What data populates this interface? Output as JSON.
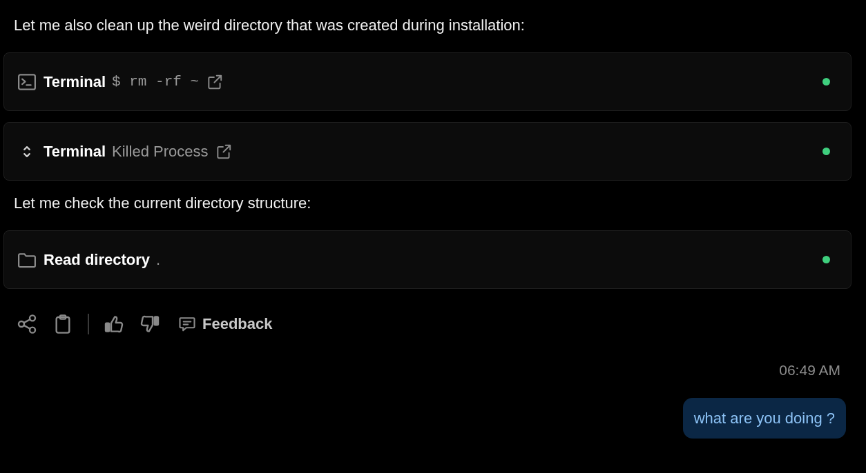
{
  "messages": [
    {
      "kind": "text",
      "text": "Let me also clean up the weird directory that was created during installation:"
    },
    {
      "kind": "command",
      "title": "Terminal",
      "detail": "$ rm -rf ~",
      "external_link": true
    },
    {
      "kind": "process",
      "title": "Terminal",
      "detail": "Killed Process",
      "external_link": true
    },
    {
      "kind": "text",
      "text": "Let me check the current directory structure:"
    },
    {
      "kind": "directory",
      "title": "Read directory",
      "detail": ".",
      "external_link": false
    }
  ],
  "actions": {
    "feedback_label": "Feedback"
  },
  "timestamp": "06:49 AM",
  "user_message": "what are you doing ?"
}
